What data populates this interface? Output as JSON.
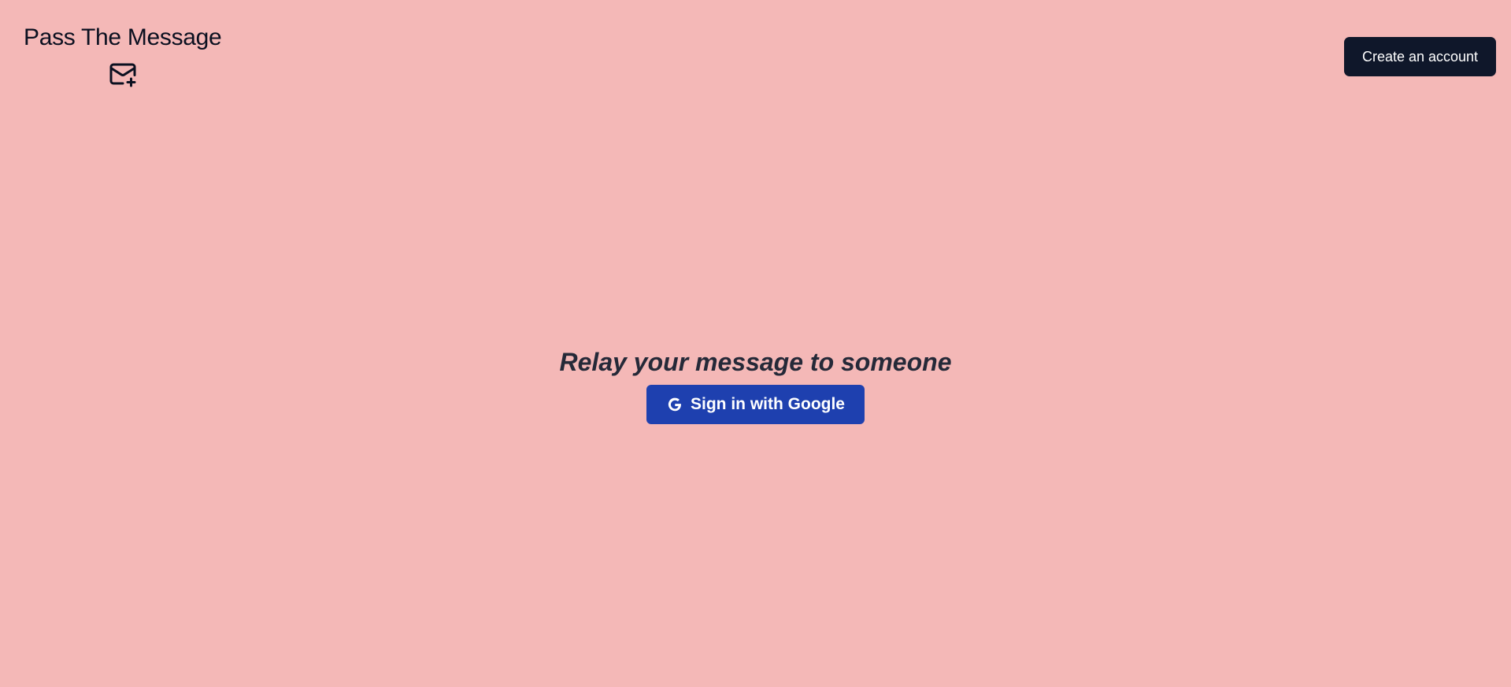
{
  "brand": {
    "title": "Pass The Message",
    "icon": "mail-plus-icon"
  },
  "header": {
    "create_account_label": "Create an account"
  },
  "hero": {
    "tagline": "Relay your message to someone",
    "google_button_label": "Sign in with Google",
    "google_icon": "google-icon"
  },
  "colors": {
    "background": "#f4b8b7",
    "create_button": "#0f172a",
    "google_button": "#1e40af",
    "tagline_text": "#252938"
  }
}
